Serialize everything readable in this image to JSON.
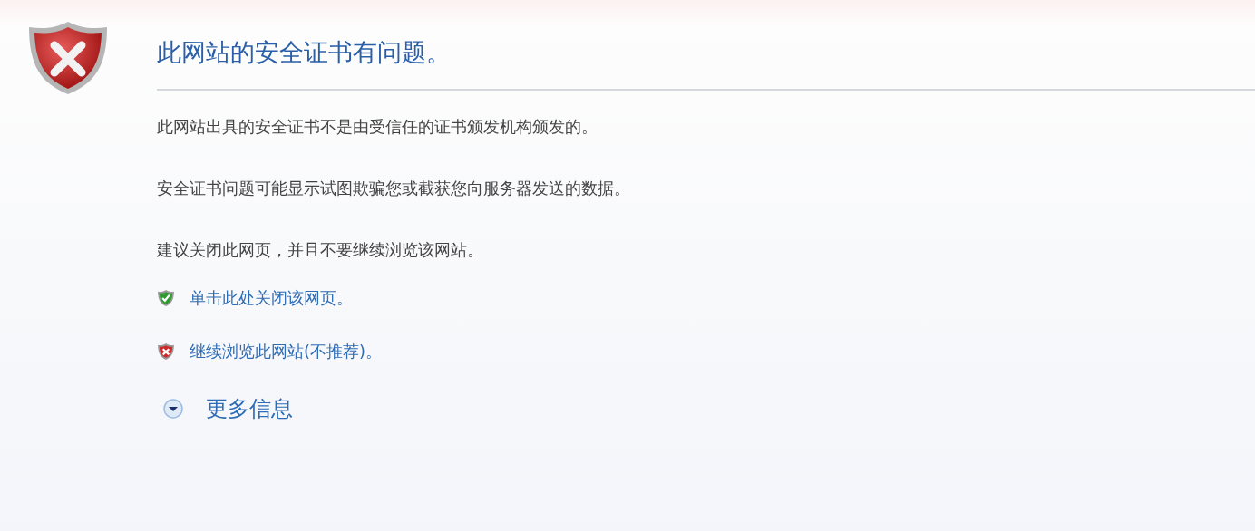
{
  "title": "此网站的安全证书有问题。",
  "paragraphs": [
    "此网站出具的安全证书不是由受信任的证书颁发机构颁发的。",
    "安全证书问题可能显示试图欺骗您或截获您向服务器发送的数据。",
    "建议关闭此网页，并且不要继续浏览该网站。"
  ],
  "links": [
    {
      "kind": "safe",
      "label": "单击此处关闭该网页。"
    },
    {
      "kind": "unsafe",
      "label": "继续浏览此网站(不推荐)。"
    }
  ],
  "more_info": {
    "label": "更多信息",
    "expanded": false
  }
}
